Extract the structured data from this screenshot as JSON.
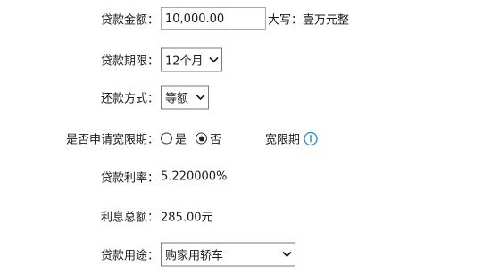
{
  "loan_amount": {
    "label": "贷款金额：",
    "value": "10,000.00",
    "uppercase": "大写：壹万元整"
  },
  "loan_term": {
    "label": "贷款期限：",
    "selected": "12个月"
  },
  "repayment_method": {
    "label": "还款方式：",
    "selected": "等额"
  },
  "grace_period": {
    "label": "是否申请宽限期：",
    "options": [
      "是",
      "否"
    ],
    "selected": "否",
    "info_label": "宽限期",
    "info_icon": "info-icon",
    "accent_color": "#1f8ce0"
  },
  "interest_rate": {
    "label": "贷款利率：",
    "value": "5.220000%"
  },
  "total_interest": {
    "label": "利息总额：",
    "value": "285.00元"
  },
  "loan_purpose": {
    "label": "贷款用途：",
    "selected": "购家用轿车"
  }
}
